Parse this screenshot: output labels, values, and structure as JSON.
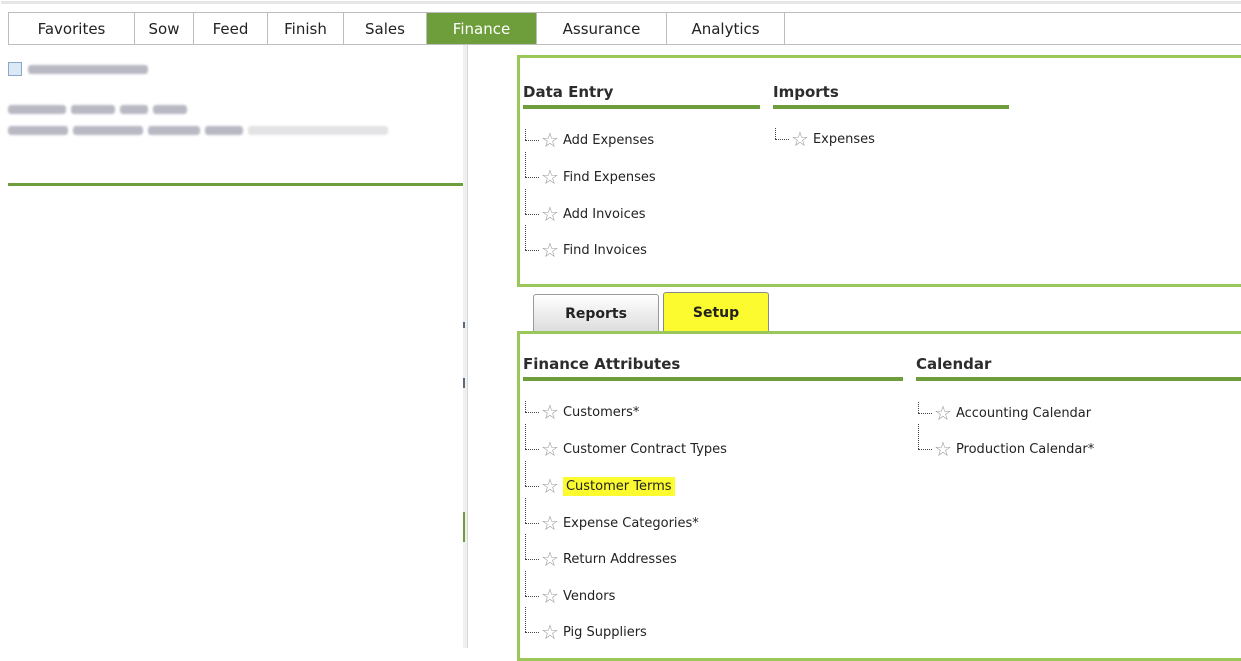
{
  "nav": {
    "tabs": [
      {
        "label": "Favorites"
      },
      {
        "label": "Sow"
      },
      {
        "label": "Feed"
      },
      {
        "label": "Finish"
      },
      {
        "label": "Sales"
      },
      {
        "label": "Finance",
        "active": true
      },
      {
        "label": "Assurance"
      },
      {
        "label": "Analytics"
      }
    ]
  },
  "colors": {
    "accent": "#6e9e3c",
    "box_border": "#9ac65a",
    "highlight": "#fbfb2f"
  },
  "data_entry": {
    "title": "Data Entry",
    "items": [
      {
        "label": "Add Expenses",
        "icon": "star-icon"
      },
      {
        "label": "Find Expenses",
        "icon": "star-icon"
      },
      {
        "label": "Add Invoices",
        "icon": "star-icon"
      },
      {
        "label": "Find Invoices",
        "icon": "star-icon"
      }
    ]
  },
  "imports": {
    "title": "Imports",
    "items": [
      {
        "label": "Expenses",
        "icon": "star-icon"
      }
    ]
  },
  "subtabs": [
    {
      "label": "Reports"
    },
    {
      "label": "Setup",
      "active": true
    }
  ],
  "finance_attributes": {
    "title": "Finance Attributes",
    "items": [
      {
        "label": "Customers*"
      },
      {
        "label": "Customer Contract Types"
      },
      {
        "label": "Customer Terms",
        "highlighted": true
      },
      {
        "label": "Expense Categories*"
      },
      {
        "label": "Return Addresses"
      },
      {
        "label": "Vendors"
      },
      {
        "label": "Pig Suppliers"
      }
    ]
  },
  "calendar": {
    "title": "Calendar",
    "items": [
      {
        "label": "Accounting Calendar"
      },
      {
        "label": "Production Calendar*"
      }
    ]
  }
}
